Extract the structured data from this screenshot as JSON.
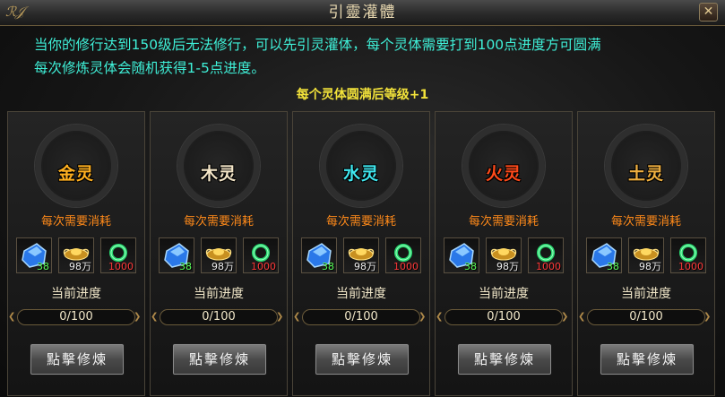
{
  "window": {
    "title": "引靈灌體",
    "close_label": "✕",
    "logo_text": "ℛ𝒥"
  },
  "intro": {
    "line1": "当你的修行达到150级后无法修行，可以先引灵灌体，每个灵体需要打到100点进度方可圆满",
    "line2": "每次修炼灵体会随机获得1-5点进度。",
    "note": "每个灵体圆满后等级+1"
  },
  "colors": {
    "intro": "#3ff0d8",
    "note": "#f2e23a",
    "cost_label": "#ff8a1a"
  },
  "cards": [
    {
      "element": "金灵",
      "element_color": "#ffb020",
      "cost_label": "每次需要消耗",
      "items": [
        {
          "icon": "blue-crystal-icon",
          "amount": "38"
        },
        {
          "icon": "gold-ingot-icon",
          "amount": "98万"
        },
        {
          "icon": "jade-ring-icon",
          "amount": "1000"
        }
      ],
      "progress_label": "当前进度",
      "progress_text": "0/100",
      "progress": 0,
      "button": "點擊修煉"
    },
    {
      "element": "木灵",
      "element_color": "#f4e6c8",
      "cost_label": "每次需要消耗",
      "items": [
        {
          "icon": "blue-crystal-icon",
          "amount": "38"
        },
        {
          "icon": "gold-ingot-icon",
          "amount": "98万"
        },
        {
          "icon": "jade-ring-icon",
          "amount": "1000"
        }
      ],
      "progress_label": "当前进度",
      "progress_text": "0/100",
      "progress": 0,
      "button": "點擊修煉"
    },
    {
      "element": "水灵",
      "element_color": "#40e8f0",
      "cost_label": "每次需要消耗",
      "items": [
        {
          "icon": "blue-crystal-icon",
          "amount": "38"
        },
        {
          "icon": "gold-ingot-icon",
          "amount": "98万"
        },
        {
          "icon": "jade-ring-icon",
          "amount": "1000"
        }
      ],
      "progress_label": "当前进度",
      "progress_text": "0/100",
      "progress": 0,
      "button": "點擊修煉"
    },
    {
      "element": "火灵",
      "element_color": "#ff4a1a",
      "cost_label": "每次需要消耗",
      "items": [
        {
          "icon": "blue-crystal-icon",
          "amount": "38"
        },
        {
          "icon": "gold-ingot-icon",
          "amount": "98万"
        },
        {
          "icon": "jade-ring-icon",
          "amount": "1000"
        }
      ],
      "progress_label": "当前进度",
      "progress_text": "0/100",
      "progress": 0,
      "button": "點擊修煉"
    },
    {
      "element": "土灵",
      "element_color": "#f0b040",
      "cost_label": "每次需要消耗",
      "items": [
        {
          "icon": "blue-crystal-icon",
          "amount": "38"
        },
        {
          "icon": "gold-ingot-icon",
          "amount": "98万"
        },
        {
          "icon": "jade-ring-icon",
          "amount": "1000"
        }
      ],
      "progress_label": "当前进度",
      "progress_text": "0/100",
      "progress": 0,
      "button": "點擊修煉"
    }
  ]
}
